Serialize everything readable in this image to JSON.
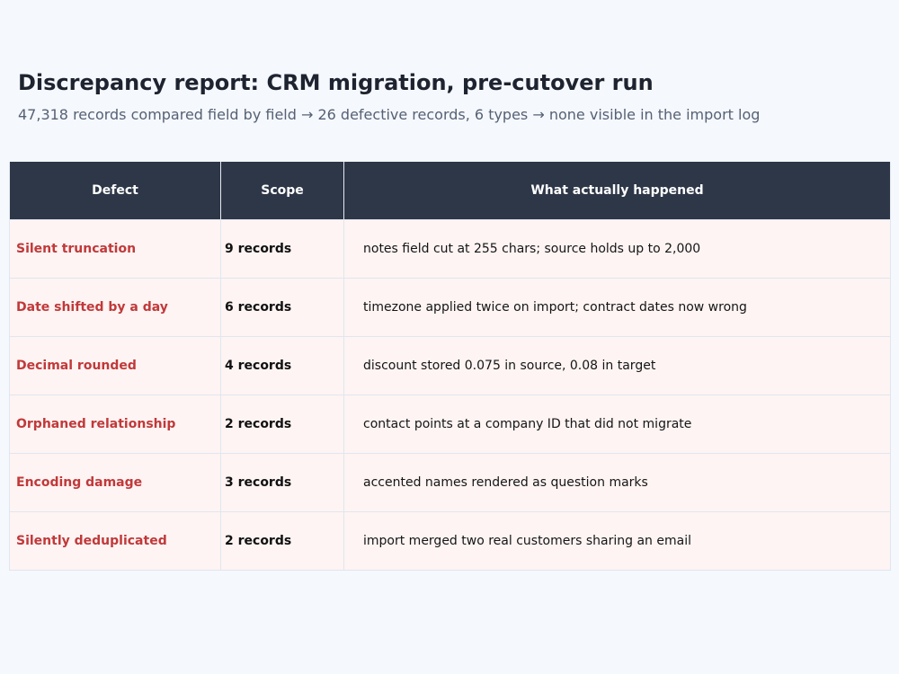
{
  "title": "Discrepancy report: CRM migration, pre-cutover run",
  "subtitle": "47,318 records compared field by field  →  26 defective records, 6 types  →  none visible in the import log",
  "table": {
    "headers": [
      "Defect",
      "Scope",
      "What actually happened"
    ],
    "rows": [
      {
        "defect": "Silent truncation",
        "scope": "9 records",
        "what": "notes field cut at 255 chars; source holds up to 2,000"
      },
      {
        "defect": "Date shifted by a day",
        "scope": "6 records",
        "what": "timezone applied twice on import; contract dates now wrong"
      },
      {
        "defect": "Decimal rounded",
        "scope": "4 records",
        "what": "discount stored 0.075 in source, 0.08 in target"
      },
      {
        "defect": "Orphaned relationship",
        "scope": "2 records",
        "what": "contact points at a company ID that did not migrate"
      },
      {
        "defect": "Encoding damage",
        "scope": "3 records",
        "what": "accented names rendered as question marks"
      },
      {
        "defect": "Silently deduplicated",
        "scope": "2 records",
        "what": "import merged two real customers sharing an email"
      }
    ]
  },
  "colors": {
    "background": "#f5f8fc",
    "header_bg": "#2e3748",
    "row_bg": "#fdf4f3",
    "defect_text": "#c1393a",
    "title_text": "#1e2330",
    "subtitle_text": "#566175"
  }
}
